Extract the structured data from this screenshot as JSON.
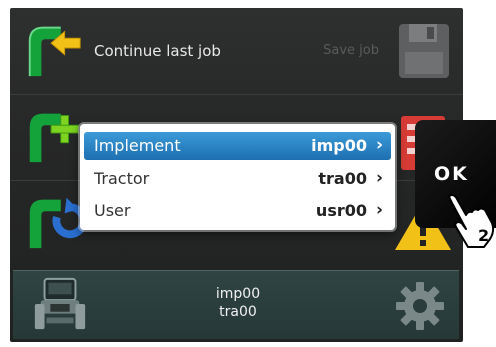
{
  "menu": {
    "continue_label": "Continue last job",
    "save_job_label": "Save job"
  },
  "popup": {
    "items": [
      {
        "name": "Implement",
        "value": "imp00",
        "selected": true
      },
      {
        "name": "Tractor",
        "value": "tra00",
        "selected": false
      },
      {
        "name": "User",
        "value": "usr00",
        "selected": false
      }
    ],
    "chevron": "›"
  },
  "status_bar": {
    "implement": "imp00",
    "tractor": "tra00"
  },
  "ok_key": {
    "label": "OK",
    "step_number": "2"
  },
  "colors": {
    "arrow_green": "#14a33a",
    "arrow_accent_yellow": "#f2c118",
    "plus_green": "#7ed321",
    "refresh_blue": "#2a6fd0",
    "selection_blue": "#1d6fb2",
    "bottom_teal": "#2a3d3c"
  },
  "icons": {
    "continue": "continue-arrow-icon",
    "new": "new-job-plus-icon",
    "resume": "refresh-icon",
    "save": "floppy-disk-icon",
    "tractor": "tractor-icon",
    "settings": "gear-icon",
    "hand": "pointing-hand-icon"
  }
}
